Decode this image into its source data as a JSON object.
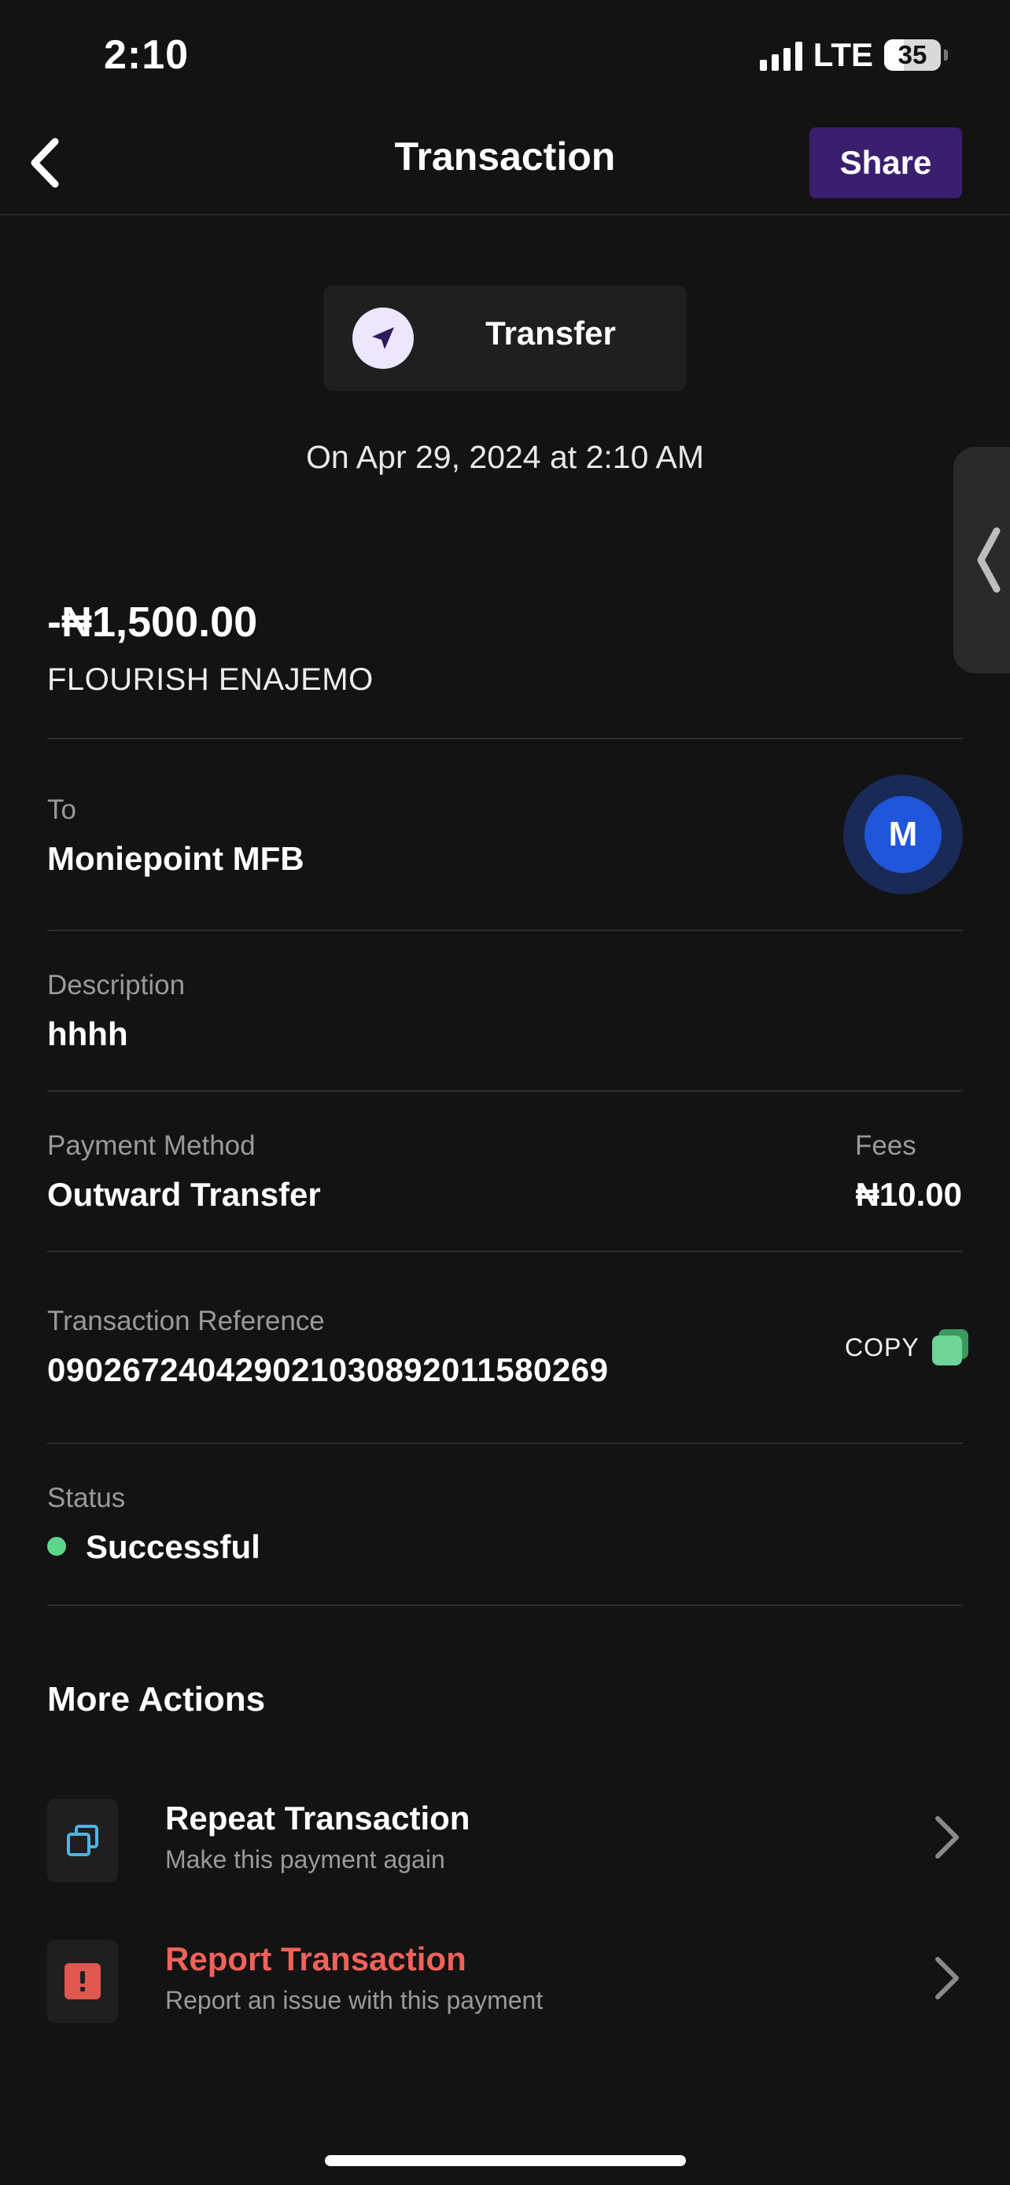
{
  "status_bar": {
    "time": "2:10",
    "network": "LTE",
    "battery": "35"
  },
  "header": {
    "title": "Transaction",
    "share_label": "Share"
  },
  "transfer": {
    "type_label": "Transfer",
    "date": "On Apr 29, 2024 at 2:10 AM"
  },
  "summary": {
    "amount": "-₦1,500.00",
    "recipient": "FLOURISH ENAJEMO"
  },
  "details": {
    "to": {
      "label": "To",
      "value": "Moniepoint MFB",
      "bank_initial": "M"
    },
    "description": {
      "label": "Description",
      "value": "hhhh"
    },
    "payment_method": {
      "label": "Payment Method",
      "value": "Outward Transfer"
    },
    "fees": {
      "label": "Fees",
      "value": "₦10.00"
    },
    "reference": {
      "label": "Transaction Reference",
      "value": "090267240429021030892011580269",
      "copy_label": "COPY"
    },
    "status": {
      "label": "Status",
      "value": "Successful"
    }
  },
  "more_actions": {
    "title": "More Actions",
    "items": [
      {
        "title": "Repeat Transaction",
        "subtitle": "Make this payment again",
        "icon": "repeat-icon",
        "color": "#ffffff"
      },
      {
        "title": "Report Transaction",
        "subtitle": "Report an issue with this payment",
        "icon": "report-icon",
        "color": "#f0625a"
      }
    ]
  },
  "colors": {
    "accent": "#3a1f6e",
    "success": "#5dd68d",
    "danger": "#f0625a",
    "bank": "#1f56db"
  }
}
